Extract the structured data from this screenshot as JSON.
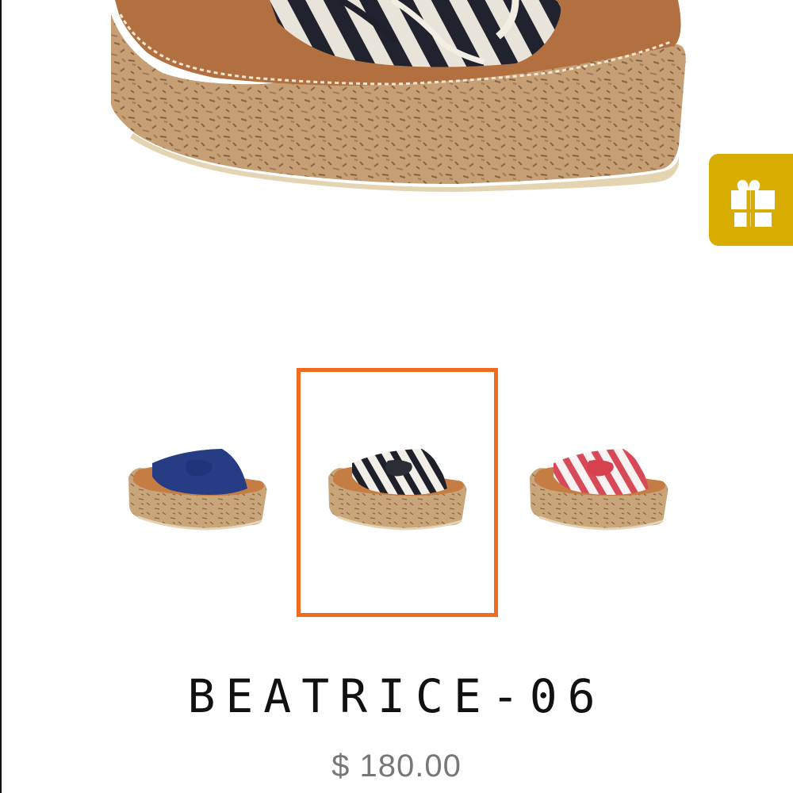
{
  "product": {
    "title": "BEATRICE-06",
    "price": "$ 180.00"
  },
  "gallery": {
    "main_image_icon": "sandal-main-image",
    "selected_index": 1,
    "thumbnails": [
      {
        "variant": "navy-denim-bow"
      },
      {
        "variant": "black-white-stripe-bow"
      },
      {
        "variant": "red-white-stripe-bow"
      }
    ]
  },
  "gift_button": {
    "icon": "gift-icon",
    "color": "#d8ad00"
  },
  "colors": {
    "selected_border": "#f26a1b",
    "title_text": "#111111",
    "price_text": "#777777"
  }
}
